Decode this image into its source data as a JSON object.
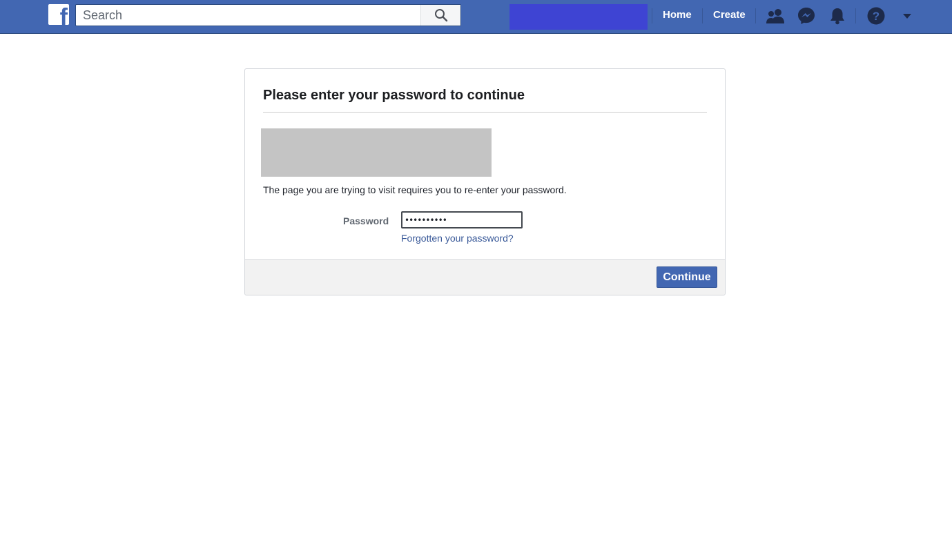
{
  "topbar": {
    "logo_letter": "f",
    "search": {
      "placeholder": "Search",
      "value": ""
    },
    "nav": {
      "home": "Home",
      "create": "Create"
    },
    "icons": [
      "friends-icon",
      "messenger-icon",
      "notifications-icon",
      "help-icon",
      "account-menu-icon"
    ],
    "colors": {
      "bar": "#4267b2",
      "redacted_name": "#3e44d3"
    }
  },
  "dialog": {
    "title": "Please enter your password to continue",
    "notice": "The page you are trying to visit requires you to re-enter your password.",
    "password_label": "Password",
    "password_value": "••••••••••",
    "forgot_link": "Forgotten your password?",
    "continue_label": "Continue"
  }
}
